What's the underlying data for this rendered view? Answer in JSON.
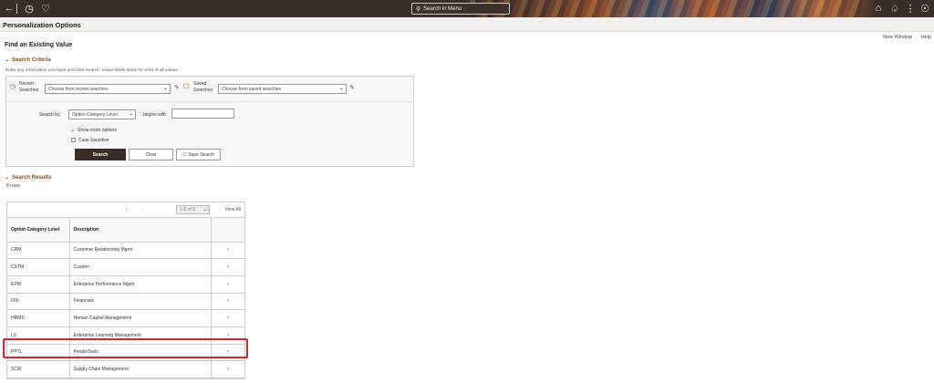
{
  "banner": {
    "search_placeholder": "Search in Menu",
    "icons": [
      "back-arrow-icon",
      "history-icon",
      "favorites-heart-icon",
      "home-icon",
      "notification-bell-icon",
      "actions-menu-icon",
      "navbar-compass-icon"
    ]
  },
  "page": {
    "title": "Personalization Options",
    "links": {
      "new_window": "New Window",
      "help": "Help"
    },
    "heading": "Find an Existing Value"
  },
  "criteria": {
    "section_title": "Search Criteria",
    "hint": "Enter any information you have and click Search. Leave fields blank for a list of all values.",
    "recent_label_1": "Recent",
    "recent_label_2": "Searches",
    "recent_placeholder": "Choose from recent searches",
    "saved_label_1": "Saved",
    "saved_label_2": "Searches",
    "saved_placeholder": "Choose from saved searches",
    "search_by_label": "Search by:",
    "search_by_value": "Option Category Level",
    "operator": "begins with",
    "search_value": "",
    "show_more": "Show more options",
    "case_sensitive": "Case Sensitive",
    "case_sensitive_checked": false,
    "buttons": {
      "search": "Search",
      "clear": "Clear",
      "save_search": "Save Search"
    }
  },
  "results": {
    "section_title": "Search Results",
    "row_count": "8 rows",
    "pager_text": "1-8 of 8",
    "view_all": "View All",
    "columns": [
      "Option Category Level",
      "Description"
    ],
    "rows": [
      {
        "level": "CRM",
        "description": "Customer Relationship Mgmt"
      },
      {
        "level": "CSTM",
        "description": "Custom"
      },
      {
        "level": "EPM",
        "description": "Enterprise Performance Mgmt"
      },
      {
        "level": "FIN",
        "description": "Financials"
      },
      {
        "level": "HRMS",
        "description": "Human Capital Management"
      },
      {
        "level": "LS",
        "description": "Enterprise Learning Management"
      },
      {
        "level": "PPTL",
        "description": "PeopleTools"
      },
      {
        "level": "SCM",
        "description": "Supply Chain Management"
      }
    ],
    "highlighted_row": "PPTL",
    "highlight_color": "#d9232d"
  },
  "colors": {
    "accent": "#8a4a1e",
    "banner": "#3a2d28",
    "primary_button": "#3a2d28"
  }
}
